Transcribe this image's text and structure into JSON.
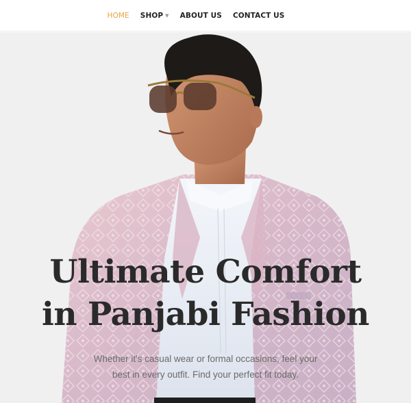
{
  "nav": {
    "items": [
      {
        "label": "HOME",
        "active": true
      },
      {
        "label": "SHOP",
        "has_dropdown": true
      },
      {
        "label": "ABOUT US"
      },
      {
        "label": "CONTACT US"
      }
    ],
    "dropdown_icon": "chevron-down-icon"
  },
  "hero": {
    "headline_line1": "Ultimate Comfort",
    "headline_line2": "in Panjabi Fashion",
    "subtext_line1": "Whether it's casual wear or formal occasions, feel your",
    "subtext_line2": "best in every outfit. Find your perfect fit today.",
    "image": "model-in-panjabi-photo",
    "cta_icon": "shop-button"
  },
  "colors": {
    "accent": "#e8a23c",
    "nav_text": "#222222",
    "hero_background": "#f0f0f0",
    "headline": "#2a2a2a",
    "subtext": "#6a6a6a",
    "button": "#1e1e1e"
  }
}
